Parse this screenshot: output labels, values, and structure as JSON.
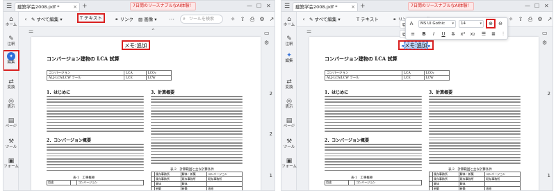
{
  "tab_title": "建築学会2008.pdf *",
  "tab_close": "×",
  "new_tab": "+",
  "promo": "7日間のリースナブルなAI体験！",
  "window_controls": [
    "—",
    "☐",
    "✕"
  ],
  "toolbar": {
    "edit_all": "すべて編集",
    "text": "テキスト",
    "link": "リンク",
    "image": "画像",
    "search_placeholder": "ツールを検索"
  },
  "sidebar": [
    {
      "icon": "⌂",
      "label": "ホーム"
    },
    {
      "icon": "✎",
      "label": "注釈"
    },
    {
      "icon": "✦",
      "label": "編集"
    },
    {
      "icon": "⇄",
      "label": "変換"
    },
    {
      "icon": "◎",
      "label": "表示"
    },
    {
      "icon": "▤",
      "label": "ページ"
    },
    {
      "icon": "⚒",
      "label": "ツール"
    },
    {
      "icon": "▣",
      "label": "フォーム"
    }
  ],
  "document": {
    "memo_text": "メモ:追加",
    "title": "コンバージョン建物の LCA 試算",
    "info_table": [
      [
        "コンバージョン",
        "LCA",
        "LCO₂"
      ],
      [
        "ALJ-LCA/LCW ツール",
        "LCE",
        "LCW"
      ]
    ],
    "section1": "1．はじめに",
    "section2": "2．コンバージョン概要",
    "section3": "3．計算概要",
    "table1_caption": "表-1　工事概要",
    "table2_caption": "表-2　計算範囲と主な計算条件",
    "table1_headers": [
      "用途",
      "",
      "コンバージョン"
    ],
    "table2_headers": [
      "",
      "既存事務所",
      "解体・新築",
      "コンバージョン"
    ],
    "table2_rows": [
      [
        "",
        "既存事務所",
        "既存事務所",
        "既存事務所"
      ],
      [
        "",
        "解体",
        "解体",
        ""
      ],
      [
        "",
        "新築",
        "新築",
        "改修"
      ]
    ],
    "page_numbers": [
      "2",
      "2",
      "1"
    ]
  },
  "format_panel": {
    "font": "MS UI Gothic",
    "size": "14"
  },
  "page_right_labels": [
    "2",
    "1"
  ]
}
